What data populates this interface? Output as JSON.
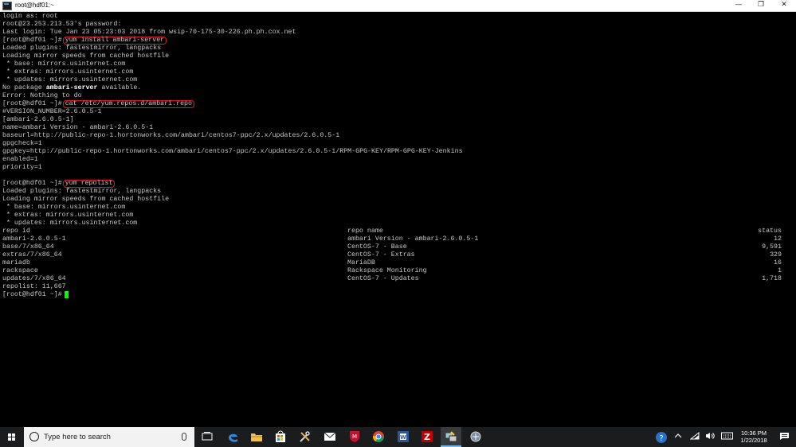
{
  "window": {
    "title": "root@hdf01:~",
    "minimize_glyph": "—",
    "maximize_glyph": "❐",
    "close_glyph": "✕"
  },
  "terminal": {
    "lines": [
      {
        "text": "login as: root"
      },
      {
        "text": "root@23.253.213.53's password:"
      },
      {
        "text": "Last login: Tue Jan 23 05:23:03 2018 from wsip-70-175-30-226.ph.ph.cox.net"
      },
      {
        "prompt": "[root@hdf01 ~]#",
        "command": "yum install ambari-server",
        "highlight": true
      },
      {
        "text": "Loaded plugins: fastestmirror, langpacks"
      },
      {
        "text": "Loading mirror speeds from cached hostfile"
      },
      {
        "text": " * base: mirrors.usinternet.com"
      },
      {
        "text": " * extras: mirrors.usinternet.com"
      },
      {
        "text": " * updates: mirrors.usinternet.com"
      },
      {
        "pre": "No package ",
        "bold": "ambari-server",
        "post": " available."
      },
      {
        "text": "Error: Nothing to do"
      },
      {
        "prompt": "[root@hdf01 ~]#",
        "command": "cat /etc/yum.repos.d/ambari.repo",
        "highlight": true
      },
      {
        "text": "#VERSION_NUMBER=2.6.0.5-1"
      },
      {
        "text": "[ambari-2.6.0.5-1]"
      },
      {
        "text": "name=ambari Version - ambari-2.6.0.5-1"
      },
      {
        "text": "baseurl=http://public-repo-1.hortonworks.com/ambari/centos7-ppc/2.x/updates/2.6.0.5-1"
      },
      {
        "text": "gpgcheck=1"
      },
      {
        "text": "gpgkey=http://public-repo-1.hortonworks.com/ambari/centos7-ppc/2.x/updates/2.6.0.5-1/RPM-GPG-KEY/RPM-GPG-KEY-Jenkins"
      },
      {
        "text": "enabled=1"
      },
      {
        "text": "priority=1"
      },
      {
        "text": ""
      },
      {
        "prompt": "[root@hdf01 ~]#",
        "command": "yum repolist",
        "highlight": true
      },
      {
        "text": "Loaded plugins: fastestmirror, langpacks"
      },
      {
        "text": "Loading mirror speeds from cached hostfile"
      },
      {
        "text": " * base: mirrors.usinternet.com"
      },
      {
        "text": " * extras: mirrors.usinternet.com"
      },
      {
        "text": " * updates: mirrors.usinternet.com"
      }
    ],
    "repo_table": {
      "headers": [
        "repo id",
        "repo name",
        "status"
      ],
      "rows": [
        [
          "ambari-2.6.0.5-1",
          "ambari Version - ambari-2.6.0.5-1",
          "12"
        ],
        [
          "base/7/x86_64",
          "CentOS-7 - Base",
          "9,591"
        ],
        [
          "extras/7/x86_64",
          "CentOS-7 - Extras",
          "329"
        ],
        [
          "mariadb",
          "MariaDB",
          "16"
        ],
        [
          "rackspace",
          "Rackspace Monitoring",
          "1"
        ],
        [
          "updates/7/x86_64",
          "CentOS-7 - Updates",
          "1,718"
        ]
      ]
    },
    "repolist_summary": "repolist: 11,667",
    "final_prompt": "[root@hdf01 ~]#",
    "colors": {
      "text": "#c7c7c7",
      "highlight_border": "#e8151a",
      "cursor": "#00ff00"
    }
  },
  "taskbar": {
    "search_placeholder": "Type here to search",
    "pinned_icons": [
      "task-view-icon",
      "edge-icon",
      "file-explorer-icon",
      "store-icon",
      "tools-icon",
      "mail-icon",
      "mcafee-icon",
      "chrome-icon",
      "word-icon",
      "filezilla-icon",
      "putty-icon",
      "network-tool-icon"
    ],
    "clock_time": "10:36 PM",
    "clock_date": "1/22/2018",
    "tray_icons": [
      "help-icon",
      "chevron-up-icon",
      "wifi-icon",
      "volume-icon",
      "keyboard-icon",
      "notifications-icon"
    ]
  }
}
